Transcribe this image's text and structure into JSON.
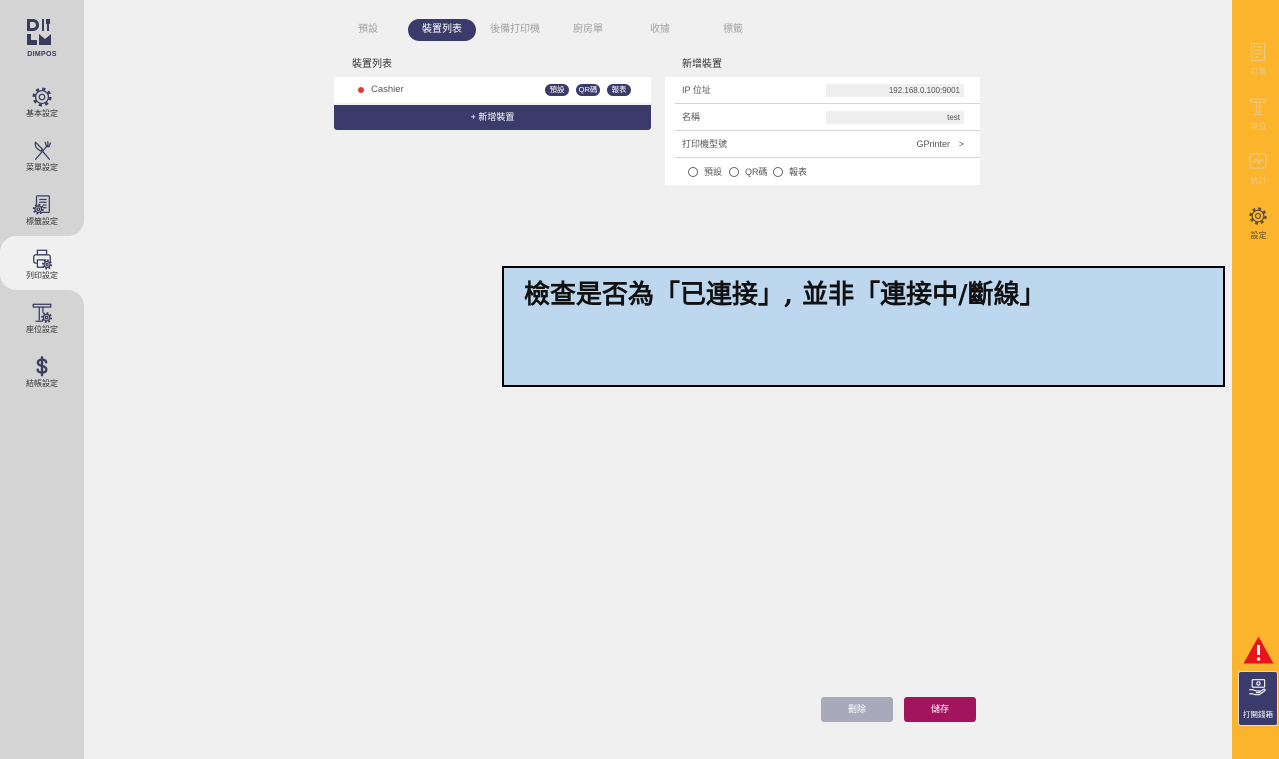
{
  "colors": {
    "main_bg": "#f0f0f0",
    "sidebar": "#d4d4d4",
    "navy": "#3b3b6b",
    "status_dot": "#e53935",
    "delete": "#a9a9bc",
    "save": "#a2145e",
    "right_bar": "#fbb42c",
    "warning": "#e8141b",
    "annotation_bg": "#bdd7ee"
  },
  "sidebar": {
    "logo_text": "DIMPOS",
    "items": [
      {
        "label": "基本設定",
        "icon": "gear-icon"
      },
      {
        "label": "菜單設定",
        "icon": "fork-knife-icon"
      },
      {
        "label": "標籤設定",
        "icon": "document-gear-icon"
      },
      {
        "label": "列印設定",
        "icon": "printer-icon",
        "active": true
      },
      {
        "label": "座位設定",
        "icon": "table-gear-icon"
      },
      {
        "label": "結帳設定",
        "icon": "dollar-icon"
      }
    ]
  },
  "tabs": {
    "items": [
      {
        "label": "預設"
      },
      {
        "label": "裝置列表",
        "active": true
      },
      {
        "label": "後備打印機"
      },
      {
        "label": "廚房單"
      },
      {
        "label": "收據"
      },
      {
        "label": "標籤"
      }
    ]
  },
  "device_list": {
    "heading": "裝置列表",
    "devices": [
      {
        "name": "Cashier",
        "badges": [
          "預設",
          "QR碼",
          "報表"
        ]
      }
    ],
    "add_button": "+ 新增裝置"
  },
  "new_device": {
    "heading": "新增裝置",
    "fields": [
      {
        "label": "IP 位址",
        "value": "192.168.0.100:9001"
      },
      {
        "label": "名稱",
        "value": "test"
      }
    ],
    "model": {
      "label": "打印機型號",
      "value": "GPrinter",
      "chevron": ">"
    },
    "options": [
      {
        "label": "預設",
        "checked": false
      },
      {
        "label": "QR碼",
        "checked": false
      },
      {
        "label": "報表",
        "checked": false
      }
    ]
  },
  "annotation": {
    "text": "檢查是否為「已連接」, 並非「連接中/斷線」"
  },
  "actions": {
    "delete": "刪除",
    "save": "儲存"
  },
  "right_bar": {
    "items": [
      {
        "label": "訂單",
        "icon": "order-icon"
      },
      {
        "label": "座位",
        "icon": "table-icon"
      },
      {
        "label": "統計",
        "icon": "stats-icon"
      },
      {
        "label": "設定",
        "icon": "gear-icon",
        "active": true
      }
    ],
    "warning_icon": "warning-icon",
    "cash_drawer": {
      "label": "打開錢箱",
      "icon": "cash-icon"
    }
  }
}
